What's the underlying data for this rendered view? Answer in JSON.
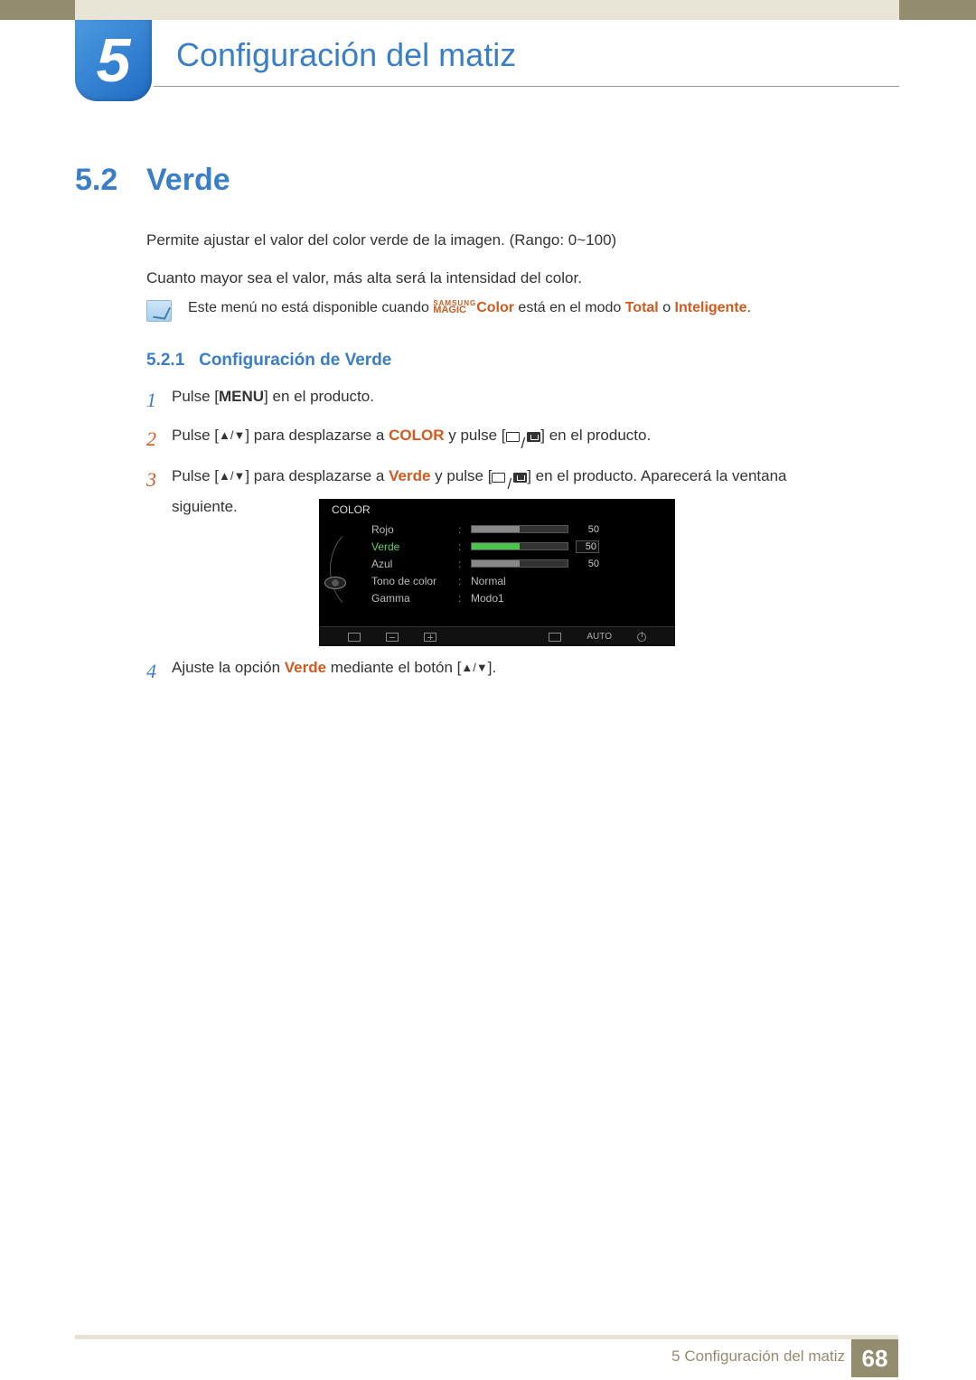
{
  "chapter": {
    "number": "5",
    "title": "Configuración del matiz"
  },
  "section": {
    "number": "5.2",
    "title": "Verde"
  },
  "paragraphs": {
    "p1": "Permite ajustar el valor del color verde de la imagen. (Rango: 0~100)",
    "p2": "Cuanto mayor sea el valor, más alta será la intensidad del color."
  },
  "note": {
    "pre": "Este menú no está disponible cuando ",
    "brand_top": "SAMSUNG",
    "brand_bottom": "MAGIC",
    "brand_suffix": "Color",
    "mid": " está en el modo ",
    "mode1": "Total",
    "or": " o ",
    "mode2": "Inteligente",
    "end": "."
  },
  "subsection": {
    "number": "5.2.1",
    "title": "Configuración de Verde"
  },
  "steps": {
    "s1": {
      "num": "1",
      "pre": "Pulse [",
      "menu": "MENU",
      "post": "] en el producto."
    },
    "s2": {
      "num": "2",
      "pre": "Pulse [",
      "mid1": "] para desplazarse a ",
      "kw": "COLOR",
      "mid2": " y pulse [",
      "post": "] en el producto."
    },
    "s3": {
      "num": "3",
      "pre": "Pulse [",
      "mid1": "] para desplazarse a ",
      "kw": "Verde",
      "mid2": " y pulse [",
      "mid3": "] en el producto. Aparecerá la ventana",
      "tail": "siguiente."
    },
    "s4": {
      "num": "4",
      "pre": "Ajuste la opción ",
      "kw": "Verde",
      "mid": " mediante el botón [",
      "post": "]."
    }
  },
  "osd": {
    "title": "COLOR",
    "rows": {
      "rojo": {
        "label": "Rojo",
        "value": "50",
        "fill": 50
      },
      "verde": {
        "label": "Verde",
        "value": "50",
        "fill": 50
      },
      "azul": {
        "label": "Azul",
        "value": "50",
        "fill": 50
      },
      "tono": {
        "label": "Tono de color",
        "value": "Normal"
      },
      "gamma": {
        "label": "Gamma",
        "value": "Modo1"
      }
    },
    "footer": {
      "auto": "AUTO"
    }
  },
  "footer": {
    "text": "5 Configuración del matiz",
    "page": "68"
  }
}
